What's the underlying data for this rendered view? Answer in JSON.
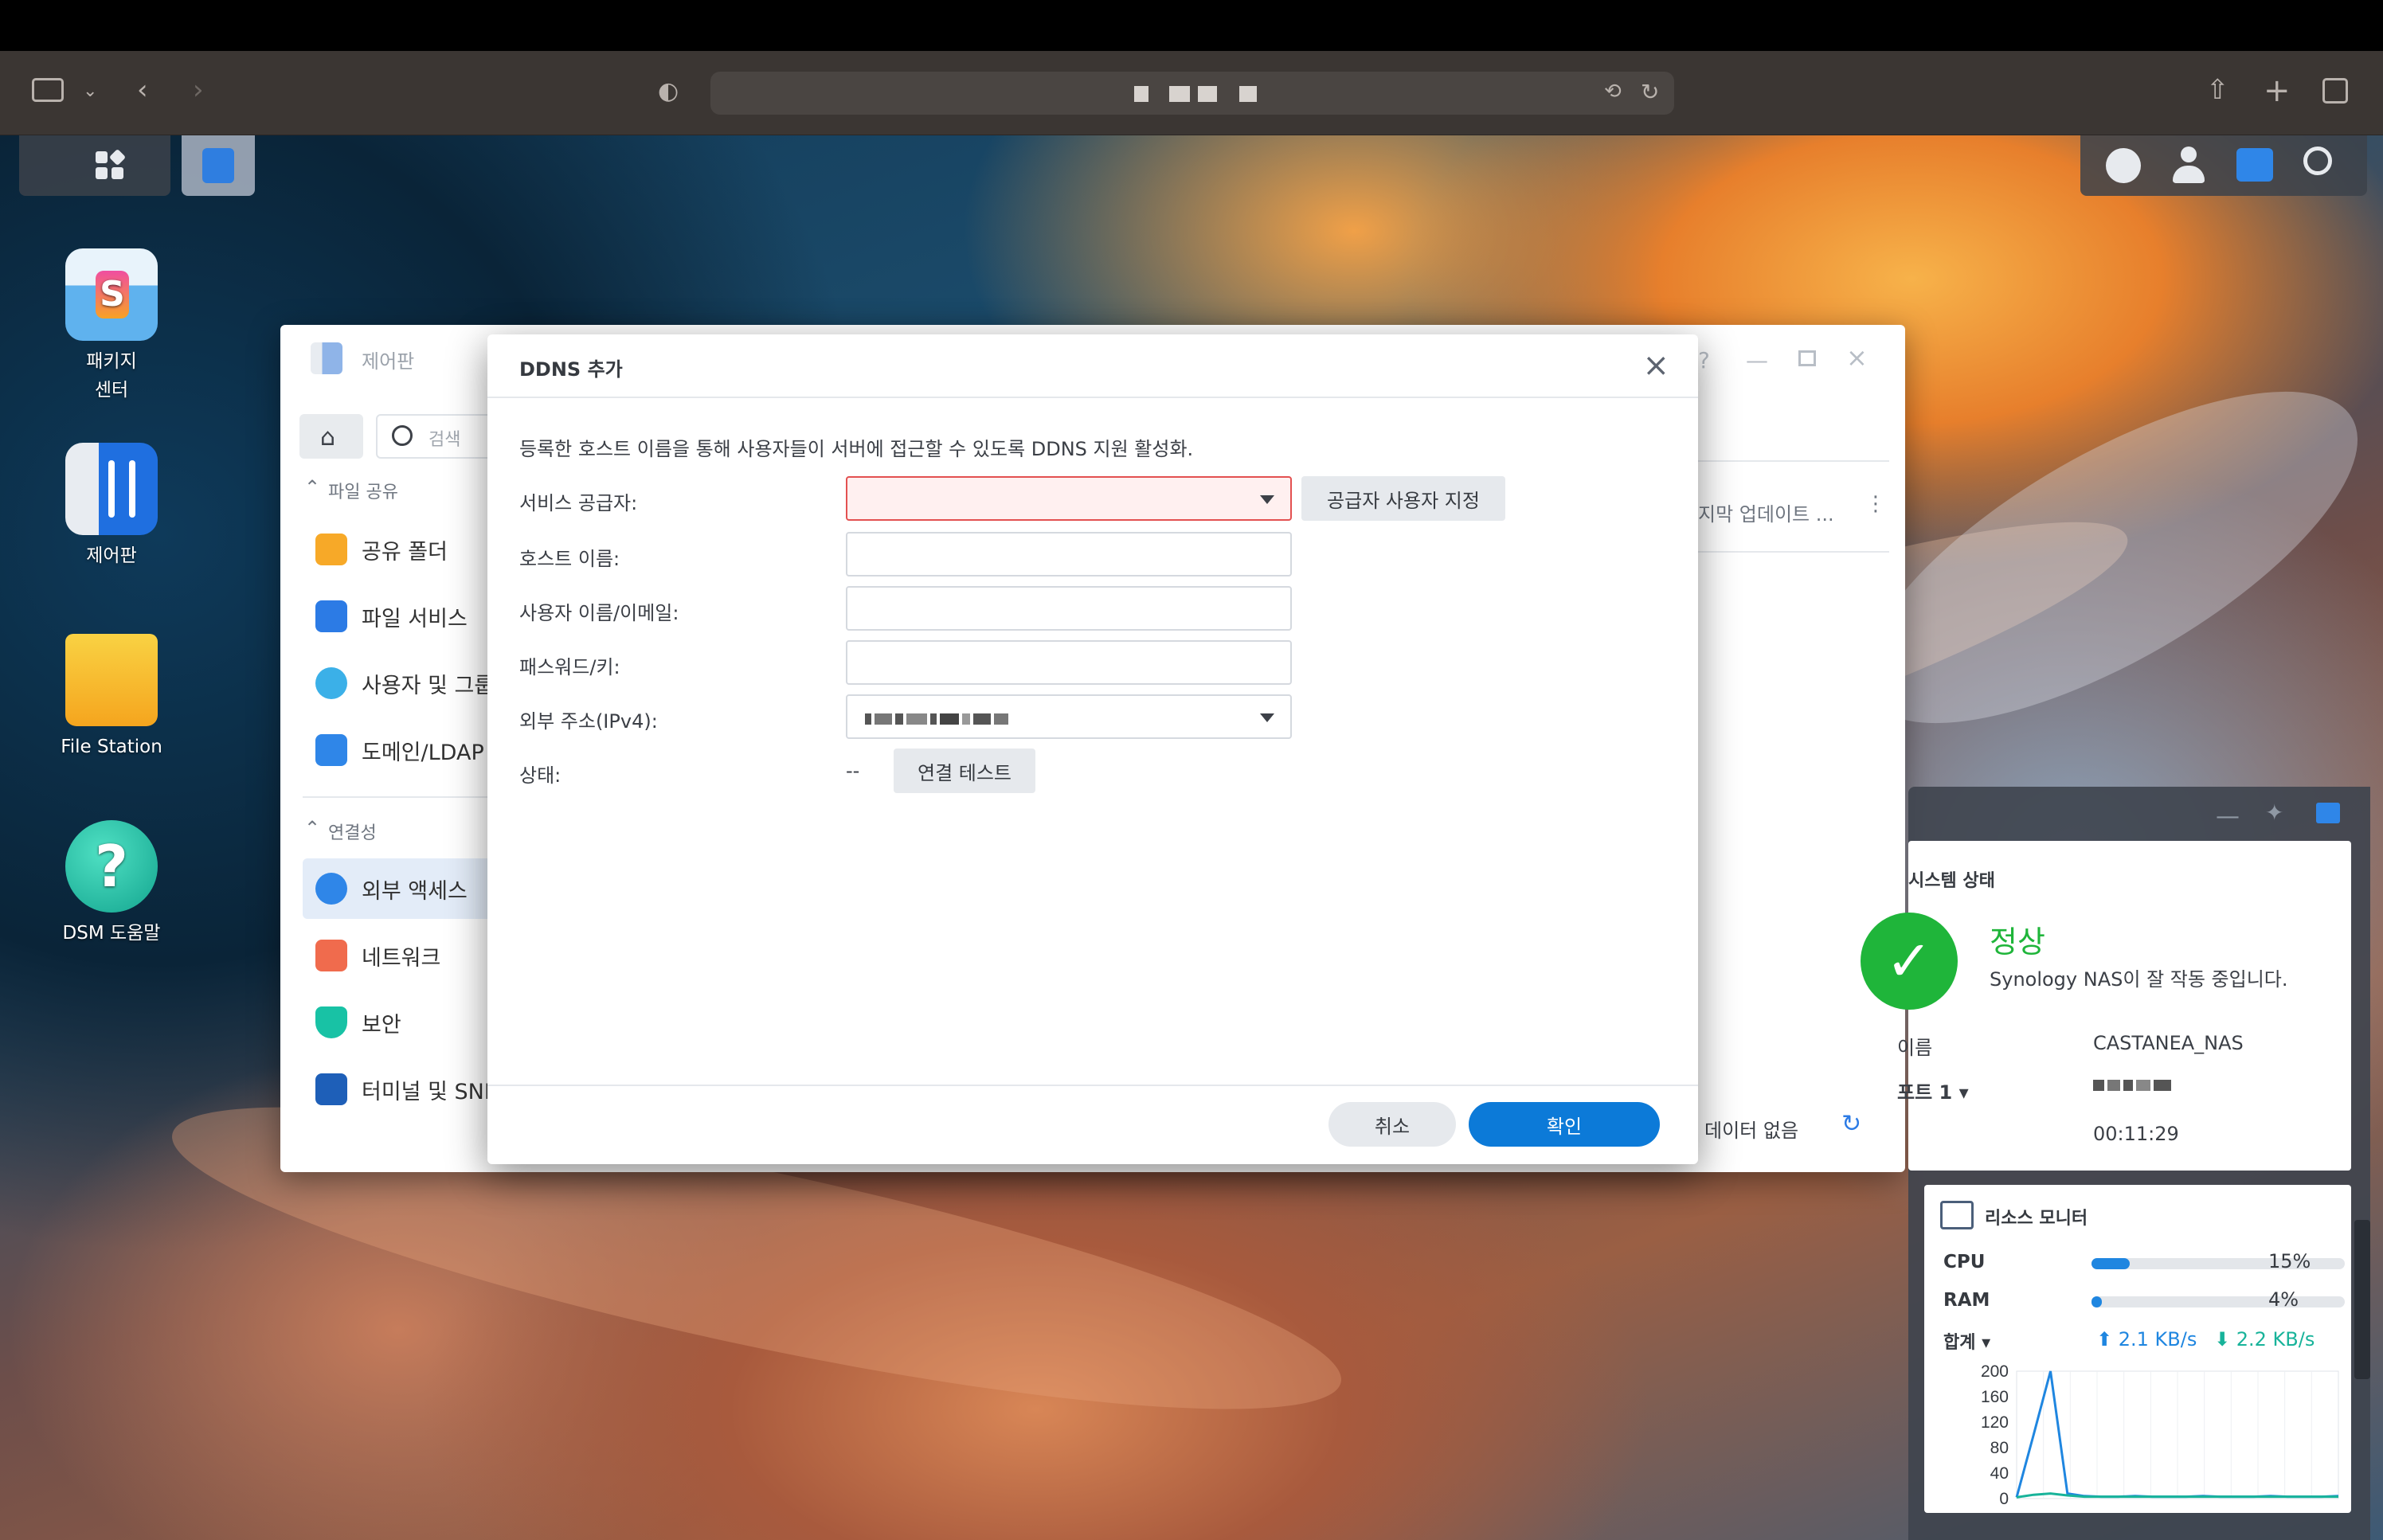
{
  "browser": {
    "url_text": "■ ▄█ █▄ ▌",
    "icons": [
      "sidebar-icon",
      "chevron-down-icon",
      "back-icon",
      "forward-icon",
      "shield-icon",
      "translate-icon",
      "reload-icon",
      "share-icon",
      "plus-icon",
      "tabs-icon"
    ]
  },
  "desktop": {
    "icons": [
      {
        "label": "패키지\n센터"
      },
      {
        "label": "제어판"
      },
      {
        "label": "File Station"
      },
      {
        "label": "DSM 도움말"
      }
    ]
  },
  "control_panel": {
    "title": "제어판",
    "search_placeholder": "검색",
    "sections": {
      "file_sharing": "파일 공유",
      "connectivity": "연결성"
    },
    "items": {
      "shared_folder": "공유 폴더",
      "file_services": "파일 서비스",
      "user_group": "사용자 및 그룹",
      "domain_ldap": "도메인/LDAP",
      "external_access": "외부 액세스",
      "network": "네트워크",
      "security": "보안",
      "terminal_snmp": "터미널 및 SNMP"
    },
    "last_update_col": "지막 업데이트 ...",
    "no_data": "데이터 없음"
  },
  "dialog": {
    "title": "DDNS 추가",
    "description": "등록한 호스트 이름을 통해 사용자들이 서버에 접근할 수 있도록 DDNS 지원 활성화.",
    "fields": {
      "provider_label": "서비스 공급자:",
      "hostname_label": "호스트 이름:",
      "username_label": "사용자 이름/이메일:",
      "password_label": "패스워드/키:",
      "external_ip_label": "외부 주소(IPv4):",
      "status_label": "상태:",
      "status_value": "--"
    },
    "custom_provider_button": "공급자 사용자 지정",
    "test_connection_button": "연결 테스트",
    "cancel_button": "취소",
    "ok_button": "확인"
  },
  "system_status": {
    "title": "시스템 상태",
    "status": "정상",
    "message": "Synology NAS이 잘 작동 중입니다.",
    "name_label": "이름",
    "name_value": "CASTANEA_NAS",
    "port_label": "포트 1",
    "uptime": "00:11:29"
  },
  "resource_monitor": {
    "title": "리소스 모니터",
    "cpu_label": "CPU",
    "cpu_percent": "15%",
    "cpu_fraction": 0.15,
    "ram_label": "RAM",
    "ram_percent": "4%",
    "ram_fraction": 0.04,
    "total_label": "합계",
    "upload": "2.1 KB/s",
    "download": "2.2 KB/s",
    "y_ticks": [
      "200",
      "160",
      "120",
      "80",
      "40",
      "0"
    ]
  },
  "colors": {
    "accent": "#0c7ad8",
    "status_green": "#1fb53a",
    "error_border": "#e35151"
  },
  "chart_data": {
    "type": "line",
    "ylim": [
      0,
      200
    ],
    "x": [
      0,
      1,
      2,
      3,
      4,
      5,
      6,
      7,
      8,
      9,
      10,
      11,
      12,
      13,
      14,
      15,
      16,
      17,
      18,
      19
    ],
    "series": [
      {
        "values": [
          2,
          100,
          200,
          8,
          4,
          3,
          3,
          4,
          3,
          3,
          3,
          4,
          3,
          3,
          3,
          4,
          3,
          3,
          3,
          4
        ]
      },
      {
        "values": [
          2,
          6,
          8,
          5,
          3,
          3,
          3,
          3,
          3,
          3,
          3,
          3,
          3,
          3,
          3,
          3,
          3,
          3,
          3,
          3
        ]
      }
    ]
  }
}
